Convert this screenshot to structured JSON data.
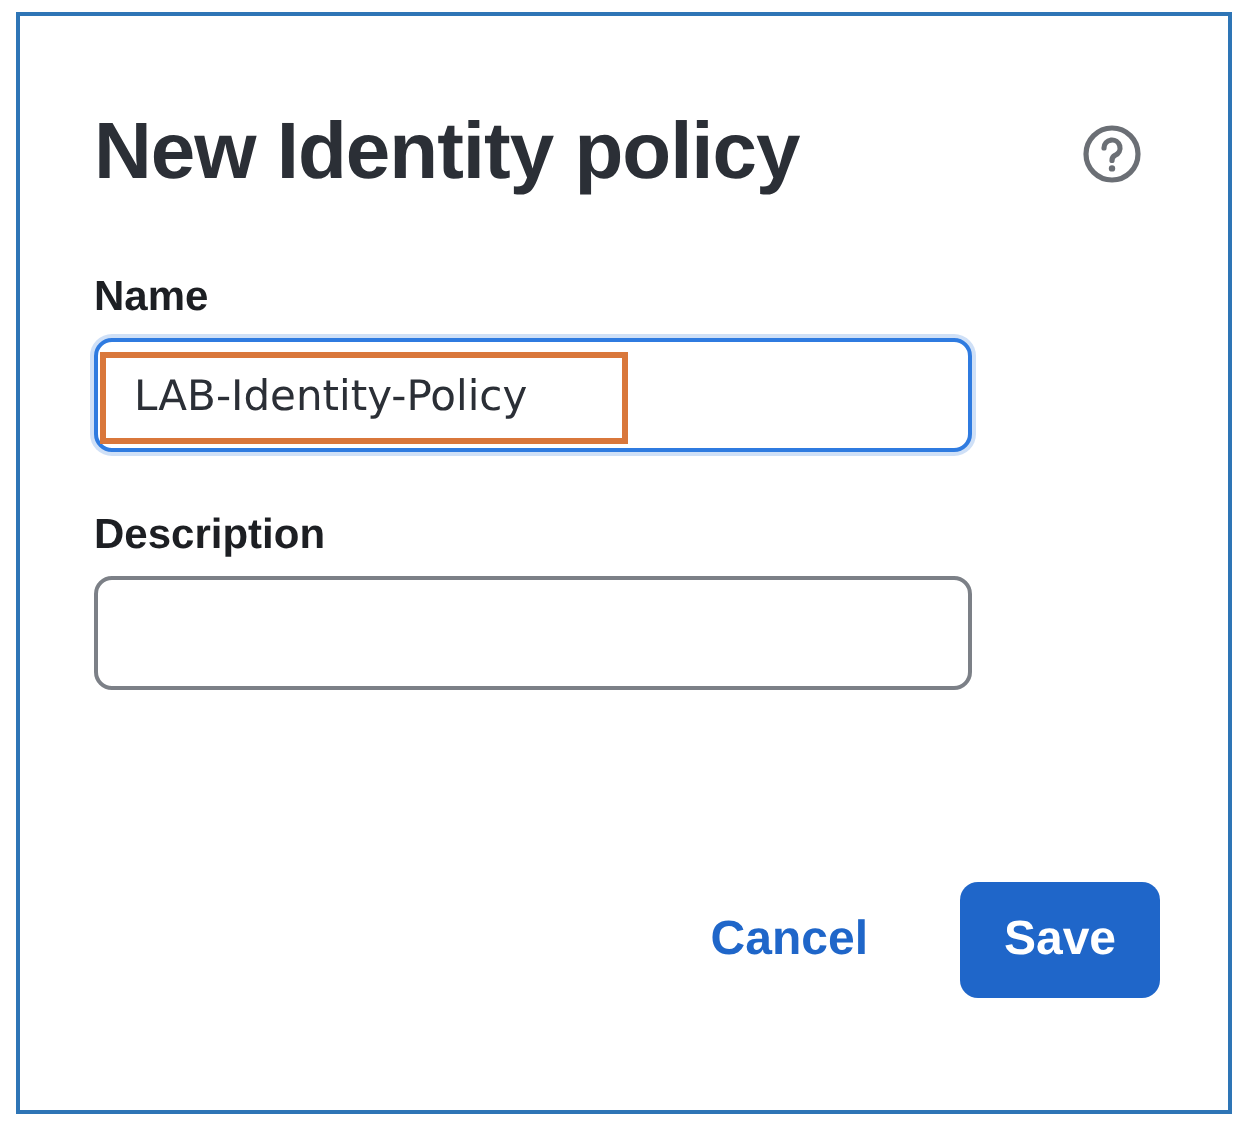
{
  "dialog": {
    "title": "New Identity policy"
  },
  "fields": [
    {
      "label": "Name",
      "value": "LAB-Identity-Policy",
      "focused": true,
      "highlighted": true
    },
    {
      "label": "Description",
      "focused": false
    }
  ],
  "buttons": [
    {
      "label": "Cancel",
      "kind": "link"
    },
    {
      "label": "Save",
      "kind": "primary"
    }
  ]
}
